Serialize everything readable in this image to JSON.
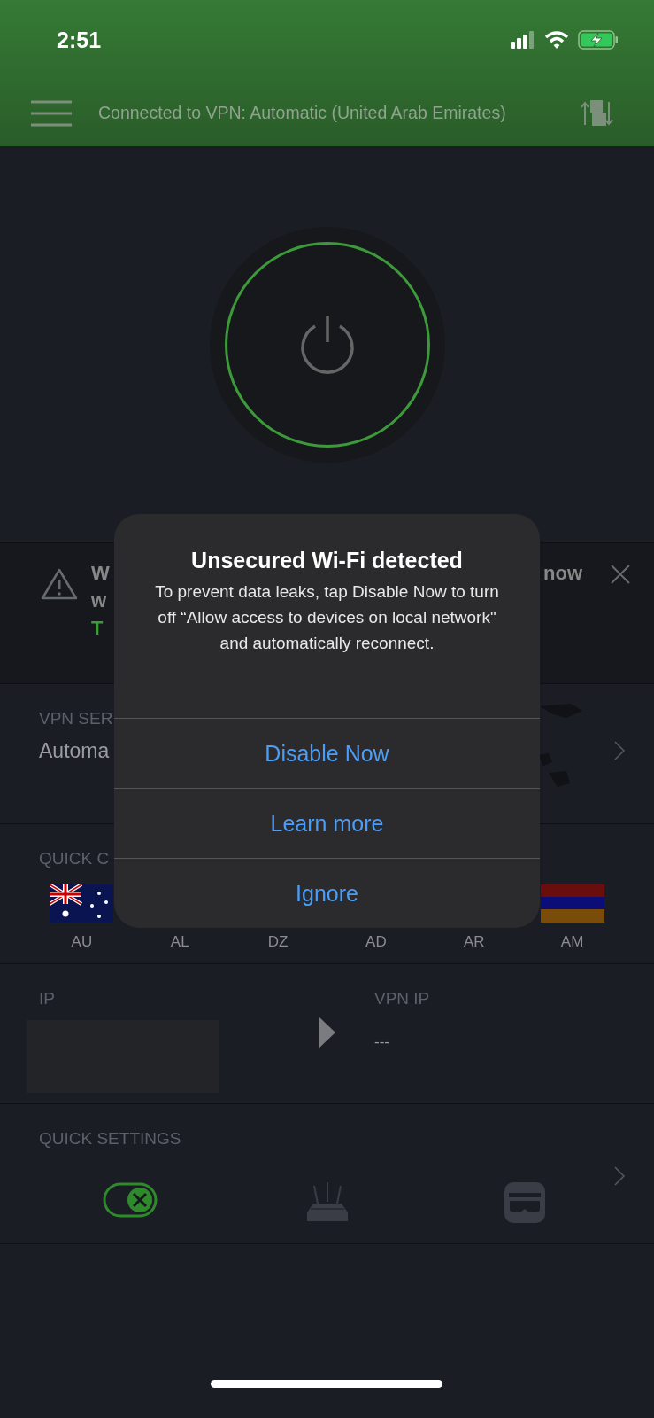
{
  "status_bar": {
    "time": "2:51"
  },
  "header": {
    "title": "Connected to VPN: Automatic (United Arab Emirates)"
  },
  "power": {
    "on": true
  },
  "banner": {
    "left_lines": [
      {
        "text": "W",
        "highlight": false
      },
      {
        "text": "w",
        "highlight": false
      },
      {
        "text": "T",
        "highlight": true
      }
    ],
    "right_text": "now"
  },
  "server": {
    "label": "VPN SER",
    "value": "Automa"
  },
  "quick_connect": {
    "label": "QUICK C",
    "countries": [
      {
        "code": "AU",
        "kind": "flag-au"
      },
      {
        "code": "AL",
        "kind": "covered"
      },
      {
        "code": "DZ",
        "kind": "covered"
      },
      {
        "code": "AD",
        "kind": "covered"
      },
      {
        "code": "AR",
        "kind": "covered"
      },
      {
        "code": "AM",
        "kind": "flag-am"
      }
    ]
  },
  "ip": {
    "label": "IP",
    "vpn_label": "VPN IP",
    "vpn_value": "---"
  },
  "quick_settings": {
    "label": "QUICK SETTINGS",
    "items": [
      {
        "kind": "kill-switch"
      },
      {
        "kind": "router"
      },
      {
        "kind": "mask"
      }
    ]
  },
  "dialog": {
    "title": "Unsecured Wi-Fi detected",
    "message": "To prevent data leaks, tap Disable Now to turn off “Allow access to devices on local network\" and automatically reconnect.",
    "buttons": [
      "Disable Now",
      "Learn more",
      "Ignore"
    ]
  }
}
